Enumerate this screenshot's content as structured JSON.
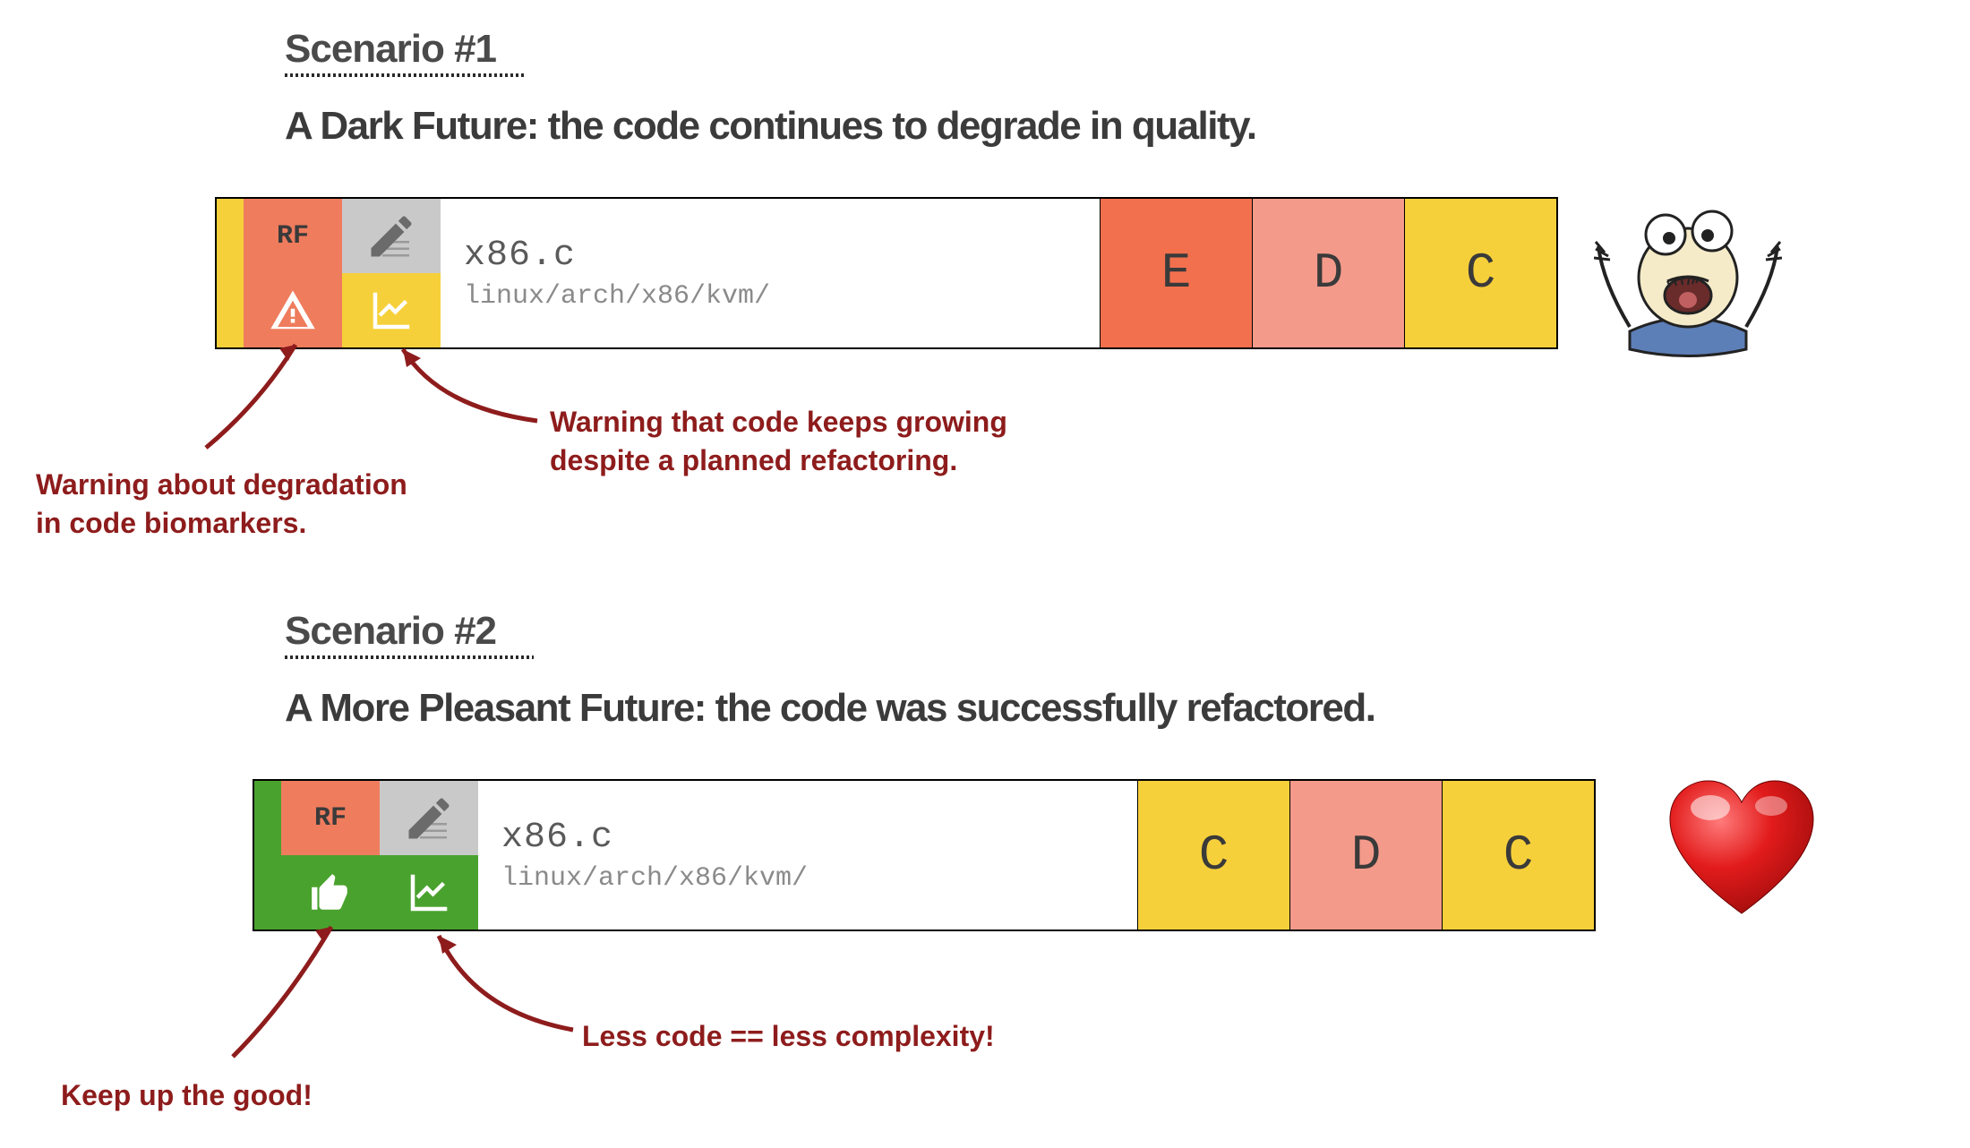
{
  "scenario1": {
    "label": "Scenario #1",
    "title": "A Dark Future: the code continues to degrade in quality.",
    "quad": {
      "rf": "RF"
    },
    "file": {
      "name": "x86.c",
      "path": "linux/arch/x86/kvm/"
    },
    "grades": [
      "E",
      "D",
      "C"
    ],
    "annot_left": "Warning about degradation\nin code biomarkers.",
    "annot_right": "Warning that code keeps growing\ndespite a planned refactoring."
  },
  "scenario2": {
    "label": "Scenario #2",
    "title": "A More Pleasant Future: the code was successfully refactored.",
    "quad": {
      "rf": "RF"
    },
    "file": {
      "name": "x86.c",
      "path": "linux/arch/x86/kvm/"
    },
    "grades": [
      "C",
      "D",
      "C"
    ],
    "annot_left": "Keep up the good!",
    "annot_right": "Less code == less complexity!"
  }
}
